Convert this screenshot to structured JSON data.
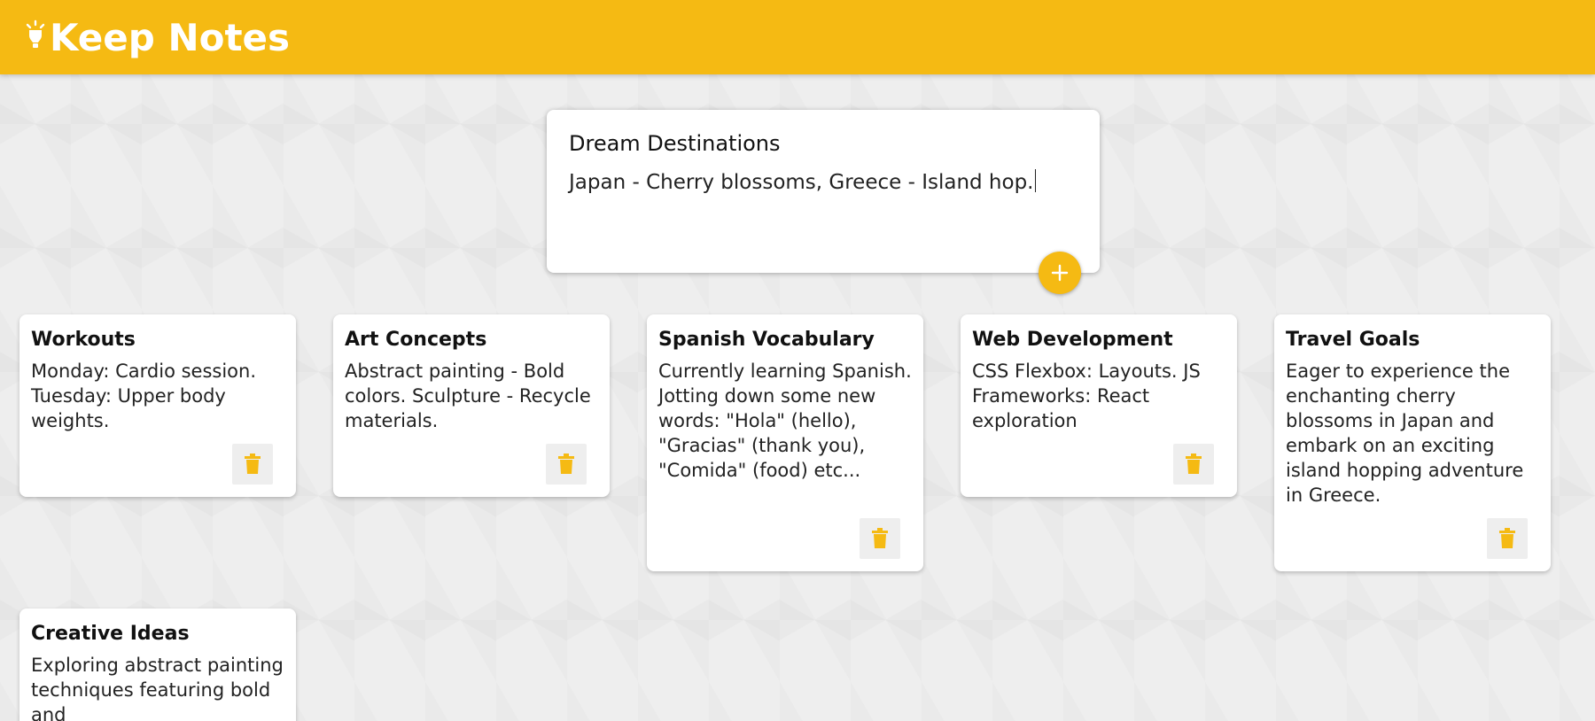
{
  "header": {
    "title": "Keep Notes",
    "icon": "lightbulb-icon"
  },
  "create_form": {
    "title_value": "Dream Destinations",
    "content_value": "Japan - Cherry blossoms, Greece - Island hop.",
    "add_icon": "plus-icon"
  },
  "notes": [
    {
      "title": "Workouts",
      "content": "Monday: Cardio session. Tuesday: Upper body weights."
    },
    {
      "title": "Art Concepts",
      "content": "Abstract painting - Bold colors. Sculpture - Recycle materials."
    },
    {
      "title": "Spanish Vocabulary",
      "content": "Currently learning Spanish. Jotting down some new words: \"Hola\" (hello), \"Gracias\" (thank you), \"Comida\" (food) etc..."
    },
    {
      "title": "Web Development",
      "content": "CSS Flexbox: Layouts. JS Frameworks: React exploration"
    },
    {
      "title": "Travel Goals",
      "content": "Eager to experience the enchanting cherry blossoms in Japan and embark on an exciting island hopping adventure in Greece."
    },
    {
      "title": "Creative Ideas",
      "content": "Exploring abstract painting techniques featuring bold and"
    }
  ],
  "colors": {
    "accent": "#f5ba13",
    "background": "#eeeeee",
    "card": "#ffffff"
  }
}
